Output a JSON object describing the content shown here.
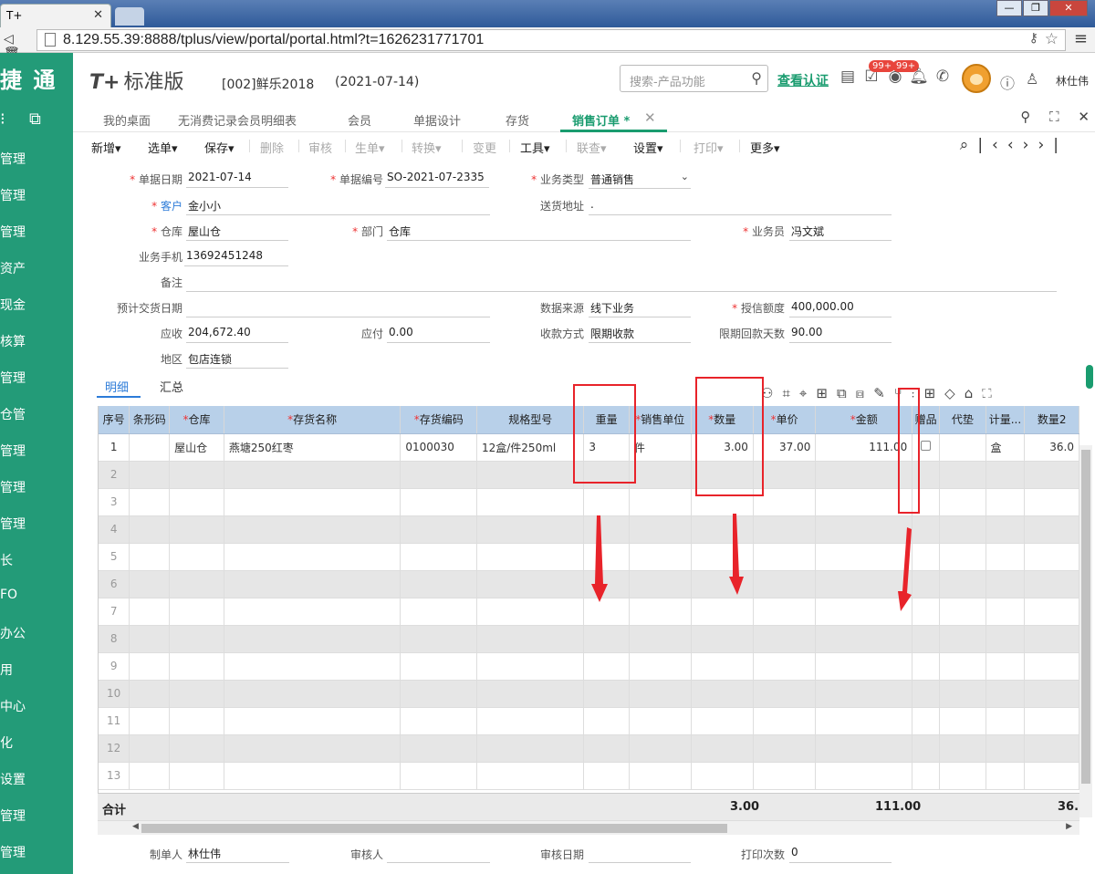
{
  "browser": {
    "tab_title": "T+",
    "url": "8.129.55.39:8888/tplus/view/portal/portal.html?t=1626231771701",
    "win_min": "—",
    "win_max": "❐",
    "win_close": "✕"
  },
  "sidebar": {
    "brand": "捷 通",
    "items": [
      "管理",
      "管理",
      "管理",
      "资产",
      "现金",
      "核算",
      "管理",
      "仓管",
      "管理",
      "管理",
      "管理",
      "长",
      "FO",
      "办公",
      "用",
      "中心",
      "化",
      "设置",
      "管理",
      "管理"
    ]
  },
  "header": {
    "logo": "T+",
    "logo_version": "标准版",
    "account": "[002]鲜乐2018",
    "date": "(2021-07-14)",
    "search_placeholder": "搜索-产品功能",
    "verify": "查看认证",
    "badge1": "99+",
    "badge2": "99+",
    "user": "林仕伟"
  },
  "tabs": [
    {
      "label": "我的桌面"
    },
    {
      "label": "无消费记录会员明细表"
    },
    {
      "label": "会员"
    },
    {
      "label": "单据设计"
    },
    {
      "label": "存货"
    },
    {
      "label": "销售订单 *"
    }
  ],
  "toolbar": {
    "new": "新增",
    "select": "选单",
    "save": "保存",
    "delete": "删除",
    "audit": "审核",
    "generate": "生单",
    "convert": "转换",
    "change": "变更",
    "tools": "工具",
    "link": "联查",
    "settings": "设置",
    "print": "打印",
    "more": "更多"
  },
  "form": {
    "doc_date_label": "单据日期",
    "doc_date": "2021-07-14",
    "doc_no_label": "单据编号",
    "doc_no": "SO-2021-07-2335",
    "biz_type_label": "业务类型",
    "biz_type": "普通销售",
    "customer_label": "客户",
    "customer": "金小小",
    "ship_addr_label": "送货地址",
    "ship_addr": ".",
    "warehouse_label": "仓库",
    "warehouse": "屋山仓",
    "dept_label": "部门",
    "dept": "仓库",
    "salesman_label": "业务员",
    "salesman": "冯文斌",
    "phone_label": "业务手机",
    "phone": "13692451248",
    "remark_label": "备注",
    "remark": "",
    "delivery_label": "预计交货日期",
    "delivery": "",
    "source_label": "数据来源",
    "source": "线下业务",
    "credit_label": "授信额度",
    "credit": "400,000.00",
    "receivable_label": "应收",
    "receivable": "204,672.40",
    "payable_label": "应付",
    "payable": "0.00",
    "pay_method_label": "收款方式",
    "pay_method": "限期收款",
    "pay_days_label": "限期回款天数",
    "pay_days": "90.00",
    "region_label": "地区",
    "region": "包店连锁"
  },
  "subtabs": {
    "detail": "明细",
    "summary": "汇总"
  },
  "grid": {
    "headers": [
      "序号",
      "条形码",
      "仓库",
      "存货名称",
      "存货编码",
      "规格型号",
      "重量",
      "销售单位",
      "数量",
      "单价",
      "金额",
      "赠品",
      "代垫",
      "计量...",
      "数量2"
    ],
    "row1": {
      "no": "1",
      "barcode": "",
      "warehouse": "屋山仓",
      "name": "燕塘250红枣",
      "code": "0100030",
      "spec": "12盒/件250ml",
      "weight": "3",
      "unit": "件",
      "qty": "3.00",
      "price": "37.00",
      "amount": "111.00",
      "unit2": "盒",
      "qty2": "36.0"
    },
    "row_numbers": [
      "2",
      "3",
      "4",
      "5",
      "6",
      "7",
      "8",
      "9",
      "10",
      "11",
      "12",
      "13"
    ],
    "total_label": "合计",
    "total_qty": "3.00",
    "total_amount": "111.00",
    "total_qty2": "36."
  },
  "footer": {
    "maker_label": "制单人",
    "maker": "林仕伟",
    "auditor_label": "审核人",
    "audit_date_label": "审核日期",
    "print_count_label": "打印次数",
    "print_count": "0"
  },
  "colors": {
    "sidebar": "#239b78",
    "accent": "#1a9c6f",
    "header_blue": "#b8d0e9",
    "annotation_red": "#e8232a"
  }
}
